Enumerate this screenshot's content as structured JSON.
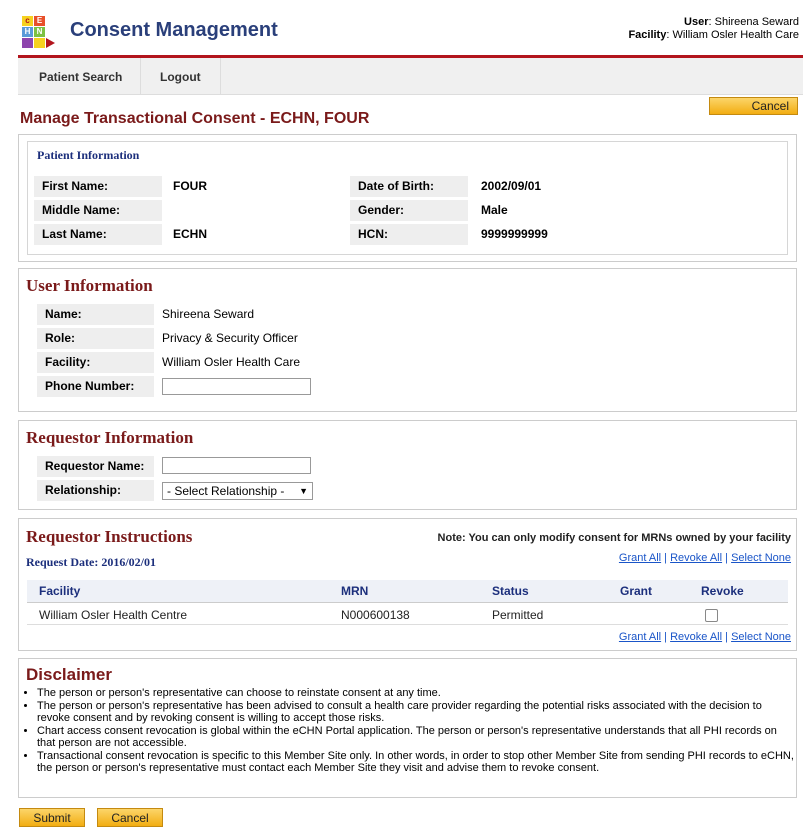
{
  "header": {
    "app_title": "Consent Management",
    "user_label": "User",
    "user_value": "Shireena Seward",
    "facility_label": "Facility",
    "facility_value": "William Osler Health Care",
    "logo_letters": [
      "c",
      "E",
      "H",
      "N"
    ]
  },
  "nav": {
    "items": [
      {
        "label": "Patient Search"
      },
      {
        "label": "Logout"
      }
    ]
  },
  "page": {
    "title": "Manage Transactional Consent - ECHN, FOUR",
    "cancel_label": "Cancel"
  },
  "patient": {
    "title": "Patient Information",
    "first_name_label": "First Name:",
    "first_name": "FOUR",
    "middle_name_label": "Middle Name:",
    "middle_name": "",
    "last_name_label": "Last Name:",
    "last_name": "ECHN",
    "dob_label": "Date of Birth:",
    "dob": "2002/09/01",
    "gender_label": "Gender:",
    "gender": "Male",
    "hcn_label": "HCN:",
    "hcn": "9999999999"
  },
  "user_info": {
    "title": "User Information",
    "name_label": "Name:",
    "name": "Shireena Seward",
    "role_label": "Role:",
    "role": "Privacy & Security Officer",
    "facility_label": "Facility:",
    "facility": "William Osler Health Care",
    "phone_label": "Phone Number:",
    "phone_value": ""
  },
  "requestor_info": {
    "title": "Requestor Information",
    "name_label": "Requestor Name:",
    "name_value": "",
    "relationship_label": "Relationship:",
    "relationship_selected": "- Select Relationship -"
  },
  "instructions": {
    "title": "Requestor Instructions",
    "note": "Note: You can only modify consent for MRNs owned by your facility",
    "request_date_label": "Request Date:",
    "request_date": "2016/02/01",
    "links": {
      "grant_all": "Grant All",
      "revoke_all": "Revoke All",
      "select_none": "Select None",
      "sep": "|"
    },
    "columns": [
      "Facility",
      "MRN",
      "Status",
      "Grant",
      "Revoke"
    ],
    "rows": [
      {
        "facility": "William Osler Health Centre",
        "mrn": "N000600138",
        "status": "Permitted",
        "revoke_checked": false
      }
    ]
  },
  "disclaimer": {
    "title": "Disclaimer",
    "items": [
      "The person or person's representative can choose to reinstate consent at any time.",
      "The person or person's representative has been advised to consult a health care provider regarding the potential risks associated with the decision to revoke consent and by revoking consent is willing to accept those risks.",
      "Chart access consent revocation is global within the eCHN Portal application. The person or person's representative understands that all PHI records on that person are not accessible.",
      "Transactional consent revocation is specific to this Member Site only. In other words, in order to stop other Member Site from sending PHI records to eCHN, the person or person's representative must contact each Member Site they visit and advise them to revoke consent."
    ]
  },
  "footer": {
    "submit_label": "Submit",
    "cancel_label": "Cancel"
  },
  "colors": {
    "brand_red": "#b2141c",
    "title_maroon": "#7a1a1a",
    "navy": "#1c2f7c",
    "button_orange": "#f2ad12",
    "link_blue": "#1a55c8"
  }
}
